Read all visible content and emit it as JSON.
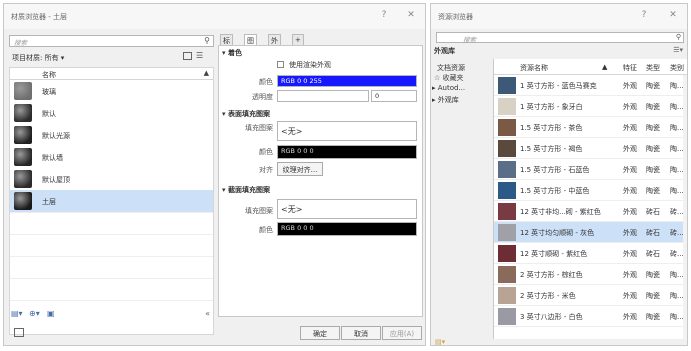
{
  "material_browser": {
    "title": "材质浏览器 - 土层",
    "help_label": "?",
    "close_label": "✕",
    "search_placeholder": "搜索",
    "filter_label": "项目材质: 所有 ▾",
    "column_name": "名称",
    "materials": [
      {
        "name": "玻璃",
        "swatch": "#6f6f6f"
      },
      {
        "name": "默认",
        "swatch": "#2c2c2c"
      },
      {
        "name": "默认光源",
        "swatch": "#1f1f1f"
      },
      {
        "name": "默认墙",
        "swatch": "#262626"
      },
      {
        "name": "默认屋顶",
        "swatch": "#2a2a2a"
      },
      {
        "name": "土层",
        "swatch": "#1a1a1a",
        "selected": true
      }
    ],
    "collapse_label": "«",
    "tabs": [
      "标识",
      "图形",
      "外观",
      "+"
    ],
    "active_tab": "图形",
    "sections": {
      "shading": "▾ 着色",
      "surface": "▾ 表面填充图案",
      "cut": "▾ 截面填充图案"
    },
    "shading": {
      "use_render_label": "使用渲染外观",
      "color_label": "颜色",
      "color_value": "RGB 0 0 255",
      "transparency_label": "透明度",
      "transparency_value": "0"
    },
    "surface_pattern": {
      "fill_label": "填充图案",
      "fill_value": "<无>",
      "color_label": "颜色",
      "color_value": "RGB 0 0 0",
      "align_label": "对齐",
      "align_button": "纹理对齐..."
    },
    "cut_pattern": {
      "fill_label": "填充图案",
      "fill_value": "<无>",
      "color_label": "颜色",
      "color_value": "RGB 0 0 0"
    },
    "ok_label": "确定",
    "cancel_label": "取消",
    "apply_label": "应用(A)"
  },
  "asset_browser": {
    "title": "资源浏览器",
    "help_label": "?",
    "close_label": "✕",
    "search_placeholder": "搜索",
    "section_label": "外观库",
    "tree": [
      "文档资源",
      "☆ 收藏夹",
      "▸ Autod...",
      "▸ 外观库"
    ],
    "columns": [
      "资源名称",
      "特征",
      "类型",
      "类别"
    ],
    "assets": [
      {
        "name": "1 英寸方形 - 蓝色马赛克",
        "feature": "外观",
        "type": "陶瓷",
        "category": "陶...",
        "swatch": "#3c5a78"
      },
      {
        "name": "1 英寸方形 - 象牙白",
        "feature": "外观",
        "type": "陶瓷",
        "category": "陶...",
        "swatch": "#d8d2c4"
      },
      {
        "name": "1.5 英寸方形 - 茶色",
        "feature": "外观",
        "type": "陶瓷",
        "category": "陶...",
        "swatch": "#7a5a44"
      },
      {
        "name": "1.5 英寸方形 - 褐色",
        "feature": "外观",
        "type": "陶瓷",
        "category": "陶...",
        "swatch": "#5a4a3e"
      },
      {
        "name": "1.5 英寸方形 - 石蓝色",
        "feature": "外观",
        "type": "陶瓷",
        "category": "陶...",
        "swatch": "#5a6e88"
      },
      {
        "name": "1.5 英寸方形 - 中蓝色",
        "feature": "外观",
        "type": "陶瓷",
        "category": "陶...",
        "swatch": "#2c5a88"
      },
      {
        "name": "12 英寸非均...砌 - 紫红色",
        "feature": "外观",
        "type": "砖石",
        "category": "砖...",
        "swatch": "#7a3a44"
      },
      {
        "name": "12 英寸均匀顺砌 - 灰色",
        "feature": "外观",
        "type": "砖石",
        "category": "砖...",
        "swatch": "#a0a0a8",
        "selected": true
      },
      {
        "name": "12 英寸顺砌 - 紫红色",
        "feature": "外观",
        "type": "砖石",
        "category": "砖...",
        "swatch": "#6e2c34"
      },
      {
        "name": "2 英寸方形 - 棕红色",
        "feature": "外观",
        "type": "陶瓷",
        "category": "陶...",
        "swatch": "#8a6a5a"
      },
      {
        "name": "2 英寸方形 - 米色",
        "feature": "外观",
        "type": "陶瓷",
        "category": "陶...",
        "swatch": "#b8a494"
      },
      {
        "name": "3 英寸八边形 - 白色",
        "feature": "外观",
        "type": "陶瓷",
        "category": "陶...",
        "swatch": "#9a9aa4"
      }
    ]
  }
}
